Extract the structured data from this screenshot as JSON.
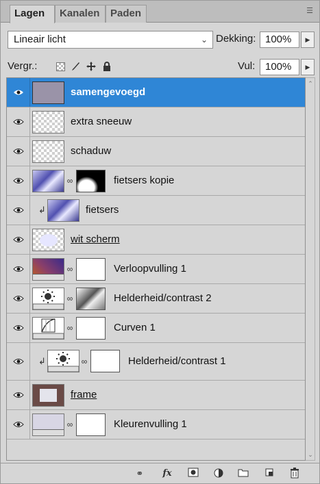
{
  "tabs": [
    {
      "label": "Lagen",
      "active": true
    },
    {
      "label": "Kanalen",
      "active": false
    },
    {
      "label": "Paden",
      "active": false
    }
  ],
  "tab_menu_icon": "panel-menu-icon",
  "blend_mode": {
    "value": "Lineair licht"
  },
  "opacity": {
    "label": "Dekking:",
    "value": "100%"
  },
  "lock": {
    "label": "Vergr.:"
  },
  "fill": {
    "label": "Vul:",
    "value": "100%"
  },
  "layers": [
    {
      "name": "samengevoegd",
      "selected": true,
      "thumb": "gray-purple",
      "underline": false
    },
    {
      "name": "extra sneeuw",
      "selected": false,
      "thumb": "transparent",
      "underline": false
    },
    {
      "name": "schaduw",
      "selected": false,
      "thumb": "transparent",
      "underline": false
    },
    {
      "name": "fietsers kopie",
      "selected": false,
      "thumb": "photo",
      "mask": "black-white",
      "underline": false
    },
    {
      "name": "fietsers",
      "selected": false,
      "thumb": "photo",
      "clipped": true,
      "underline": false
    },
    {
      "name": "wit scherm",
      "selected": false,
      "thumb": "transparent-white-blob",
      "underline": true
    },
    {
      "name": "Verloopvulling 1",
      "selected": false,
      "thumb": "gradient-fill",
      "mask": "white",
      "underline": false
    },
    {
      "name": "Helderheid/contrast 2",
      "selected": false,
      "thumb": "brightness-adjust",
      "mask": "gray-gradient",
      "underline": false
    },
    {
      "name": "Curven 1",
      "selected": false,
      "thumb": "curves-adjust",
      "mask": "white",
      "underline": false
    },
    {
      "name": "Helderheid/contrast 1",
      "selected": false,
      "thumb": "brightness-adjust",
      "mask": "white",
      "clipped": true,
      "underline": false
    },
    {
      "name": "frame",
      "selected": false,
      "thumb": "frame",
      "underline": true
    },
    {
      "name": "Kleurenvulling 1",
      "selected": false,
      "thumb": "color-fill",
      "mask": "white",
      "underline": false
    }
  ],
  "bottom_icons": [
    "link-layers-icon",
    "fx-effects-icon",
    "add-mask-icon",
    "adjustment-layer-icon",
    "new-group-icon",
    "new-layer-icon",
    "delete-layer-icon"
  ],
  "bottom_labels": {
    "fx": "fx"
  },
  "colors": {
    "selection": "#2f86d6",
    "panel": "#d6d6d6"
  }
}
